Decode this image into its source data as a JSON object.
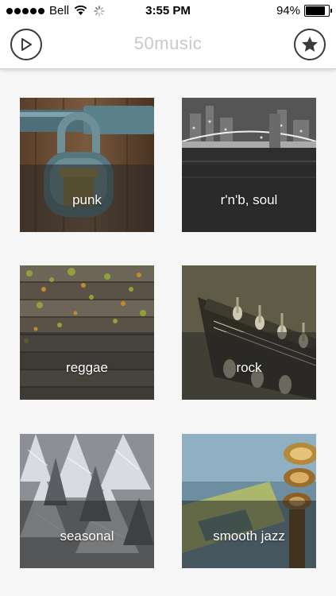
{
  "status_bar": {
    "carrier": "Bell",
    "time": "3:55 PM",
    "battery_percent": "94%",
    "battery_level": 0.94,
    "signal_bars": 5,
    "icons": [
      "signal-dots-icon",
      "wifi-icon",
      "activity-spinner-icon",
      "battery-icon"
    ]
  },
  "nav_bar": {
    "title": "50music",
    "left_button_icon": "play-icon",
    "right_button_icon": "star-icon",
    "title_color": "#c9c9c9",
    "button_color": "#3a3a3a"
  },
  "genres": [
    {
      "label": "punk"
    },
    {
      "label": "r'n'b, soul"
    },
    {
      "label": "reggae"
    },
    {
      "label": "rock"
    },
    {
      "label": "seasonal"
    },
    {
      "label": "smooth jazz"
    }
  ]
}
